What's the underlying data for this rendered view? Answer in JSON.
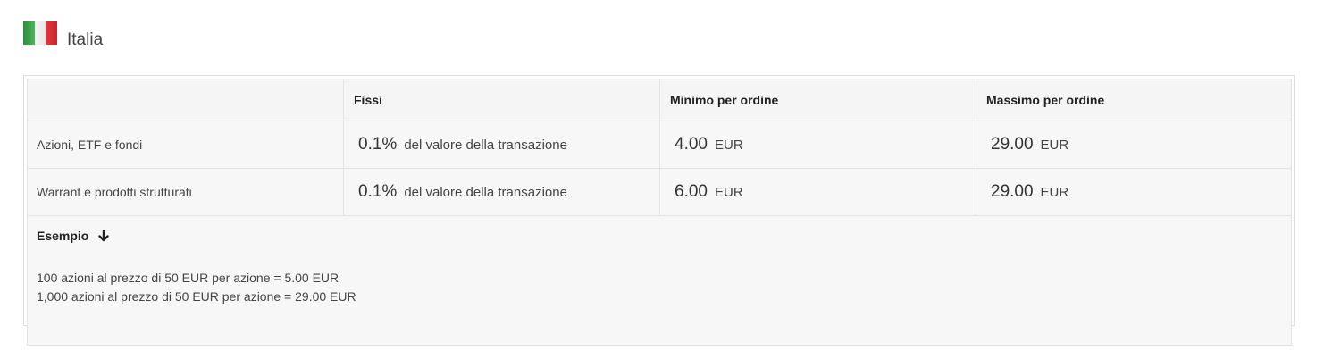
{
  "country": {
    "name": "Italia",
    "flag_icon": "italy-flag-icon",
    "flag_colors": [
      "#2e8f3e",
      "#f6f6f6",
      "#d3272c"
    ]
  },
  "table": {
    "headers": [
      "",
      "Fissi",
      "Minimo per ordine",
      "Massimo per ordine"
    ],
    "rows": [
      {
        "label": "Azioni, ETF e fondi",
        "fixed_value": "0.1%",
        "fixed_desc": "del valore della transazione",
        "min_value": "4.00",
        "min_currency": "EUR",
        "max_value": "29.00",
        "max_currency": "EUR"
      },
      {
        "label": "Warrant e prodotti strutturati",
        "fixed_value": "0.1%",
        "fixed_desc": "del valore della transazione",
        "min_value": "6.00",
        "min_currency": "EUR",
        "max_value": "29.00",
        "max_currency": "EUR"
      }
    ],
    "example": {
      "title": "Esempio",
      "arrow_icon": "arrow-down-icon",
      "lines": [
        "100 azioni al prezzo di 50 EUR per azione = 5.00 EUR",
        "1,000 azioni al prezzo di 50 EUR per azione = 29.00 EUR"
      ]
    }
  }
}
